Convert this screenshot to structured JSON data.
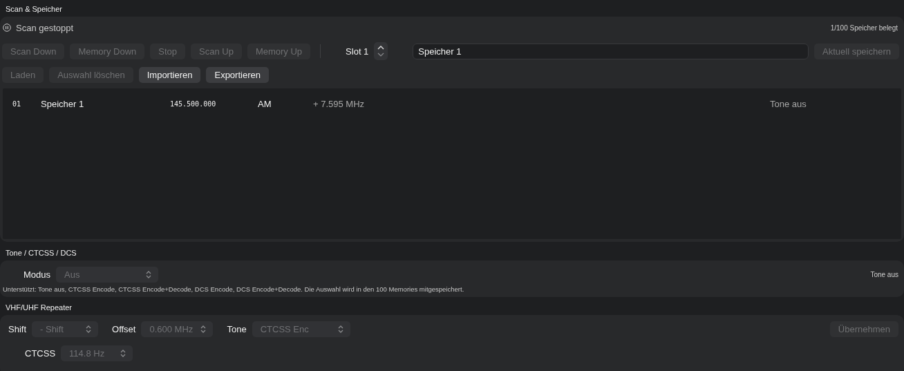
{
  "scan_section": {
    "title": "Scan & Speicher",
    "status": "Scan gestoppt",
    "usage": "1/100 Speicher belegt",
    "scan_buttons": [
      {
        "label": "Scan Down",
        "disabled": true
      },
      {
        "label": "Memory Down",
        "disabled": true
      },
      {
        "label": "Stop",
        "disabled": true
      },
      {
        "label": "Scan Up",
        "disabled": true
      },
      {
        "label": "Memory Up",
        "disabled": true
      }
    ],
    "slot": {
      "label": "Slot 1"
    },
    "name_field": {
      "value": "Speicher 1"
    },
    "save_button": {
      "label": "Aktuell speichern",
      "disabled": true
    },
    "memory_buttons": [
      {
        "label": "Laden",
        "disabled": true
      },
      {
        "label": "Auswahl löschen",
        "disabled": true
      },
      {
        "label": "Importieren",
        "disabled": false
      },
      {
        "label": "Exportieren",
        "disabled": false
      }
    ],
    "memories": [
      {
        "number": "01",
        "name": "Speicher 1",
        "frequency": "145.500.000",
        "mode": "AM",
        "offset": "+ 7.595 MHz",
        "tone": "Tone aus",
        "selected": false
      }
    ]
  },
  "tone_section": {
    "title": "Tone / CTCSS / DCS",
    "mode_label": "Modus",
    "mode_select": {
      "value": "Aus",
      "disabled": true
    },
    "status": "Tone aus",
    "note": "Unterstützt: Tone aus, CTCSS Encode, CTCSS Encode+Decode, DCS Encode, DCS Encode+Decode. Die Auswahl wird in den 100 Memories mitgespeichert."
  },
  "repeater_section": {
    "title": "VHF/UHF Repeater",
    "fields": [
      {
        "label": "Shift",
        "value": "- Shift",
        "disabled": true
      },
      {
        "label": "Offset",
        "value": "0.600 MHz",
        "disabled": true
      },
      {
        "label": "Tone",
        "value": "CTCSS Enc",
        "disabled": true
      }
    ],
    "apply_button": {
      "label": "Übernehmen",
      "disabled": true
    },
    "ctcss": {
      "label": "CTCSS",
      "value": "114.8 Hz",
      "disabled": true
    }
  }
}
